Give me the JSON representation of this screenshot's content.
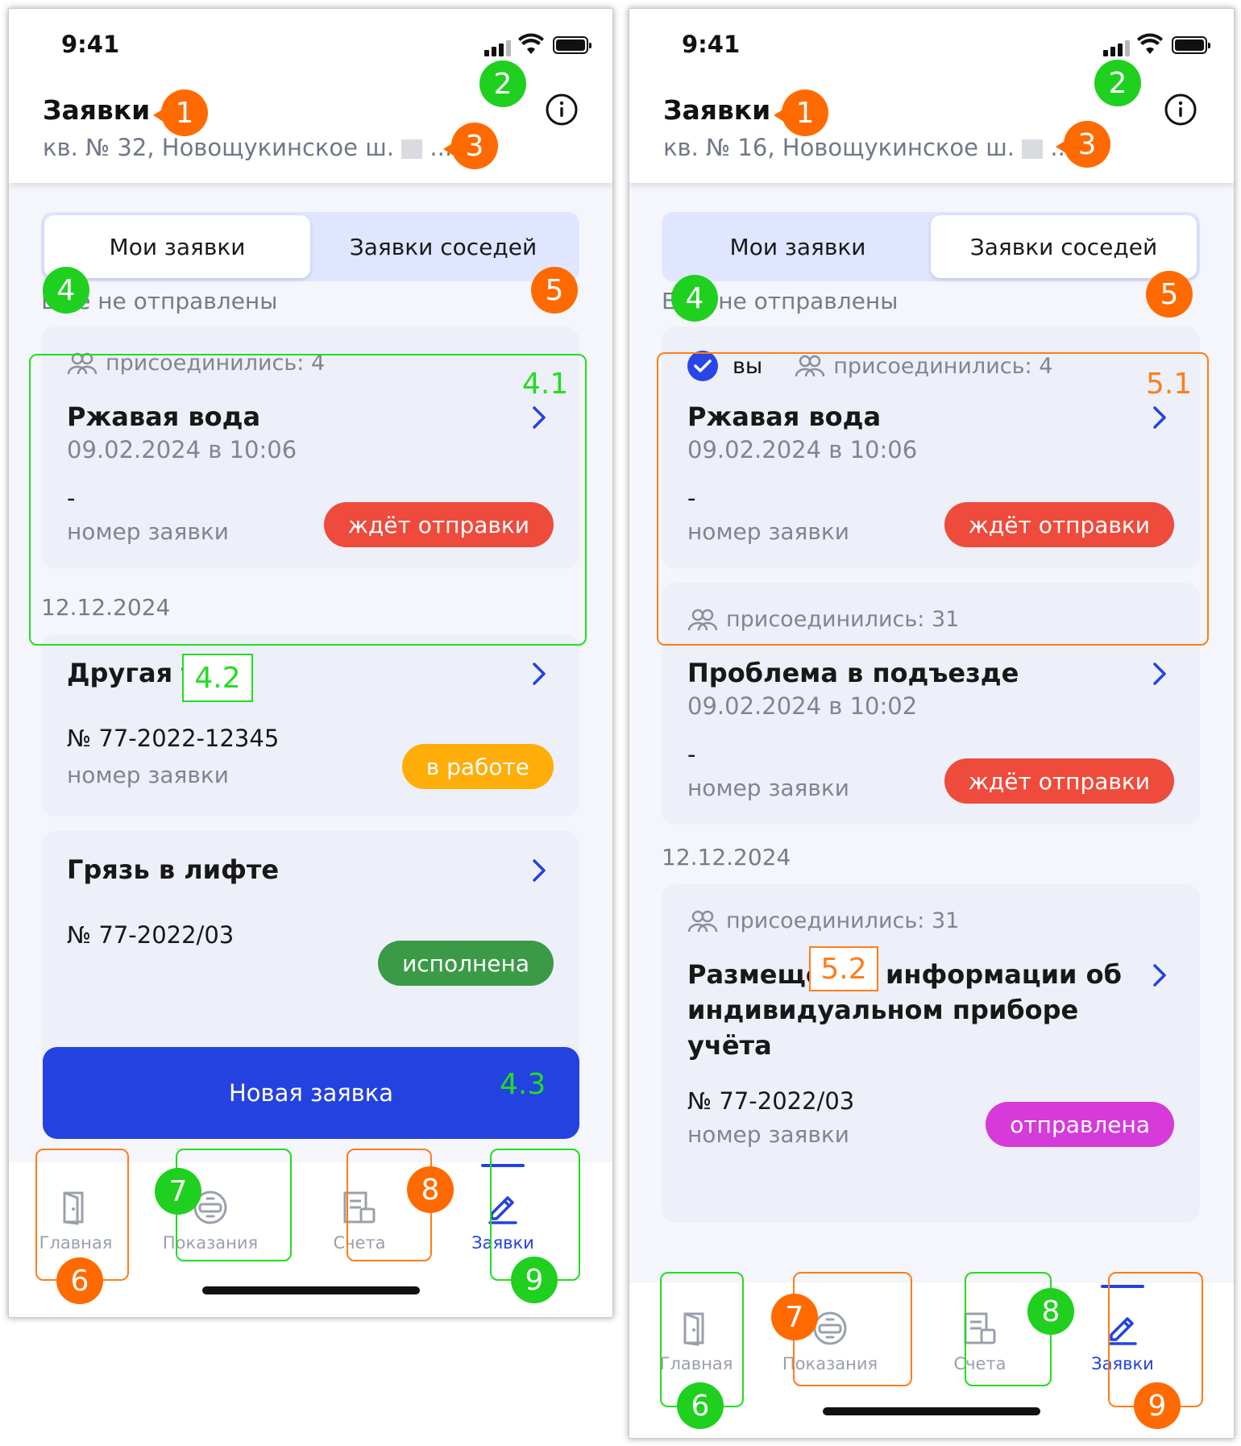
{
  "screens": [
    {
      "status": {
        "time": "9:41"
      },
      "header": {
        "title": "Заявки",
        "address": "кв. № 32, Новощукинское ш.",
        "address_tail": "..."
      },
      "tabs": {
        "mine": "Мои заявки",
        "neighbors": "Заявки соседей",
        "active": "mine"
      },
      "section_unsent": "Ещё не отправлены",
      "section_date": "12.12.2024",
      "cards": [
        {
          "joined": "присоединились: 4",
          "title": "Ржавая вода",
          "date": "09.02.2024 в 10:06",
          "number": "-",
          "number_label": "номер заявки",
          "status": "ждёт отправки",
          "status_color": "#ee4b3c"
        },
        {
          "title": "Другая тема",
          "number": "№ 77-2022-12345",
          "number_label": "номер заявки",
          "status": "в работе",
          "status_color": "#ffad08"
        },
        {
          "title": "Грязь в лифте",
          "number": "№ 77-2022/03",
          "status": "исполнена",
          "status_color": "#3a9a46"
        }
      ],
      "new_button": "Новая заявка",
      "tabbar": [
        "Главная",
        "Показания",
        "Счета",
        "Заявки"
      ],
      "annotations": {
        "n1": "1",
        "n2": "2",
        "n3": "3",
        "n4": "4",
        "n5": "5",
        "n6": "6",
        "n7": "7",
        "n8": "8",
        "n9": "9",
        "l41": "4.1",
        "l42": "4.2",
        "l43": "4.3"
      }
    },
    {
      "status": {
        "time": "9:41"
      },
      "header": {
        "title": "Заявки",
        "address": "кв. № 16, Новощукинское ш.",
        "address_tail": "..."
      },
      "tabs": {
        "mine": "Мои заявки",
        "neighbors": "Заявки соседей",
        "active": "neighbors"
      },
      "section_unsent": "Ещё не отправлены",
      "section_date": "12.12.2024",
      "cards": [
        {
          "you": "вы",
          "joined": "присоединились: 4",
          "title": "Ржавая вода",
          "date": "09.02.2024 в 10:06",
          "number": "-",
          "number_label": "номер заявки",
          "status": "ждёт отправки",
          "status_color": "#ee4b3c"
        },
        {
          "joined": "присоединились: 31",
          "title": "Проблема в подъезде",
          "date": "09.02.2024 в 10:02",
          "number": "-",
          "number_label": "номер заявки",
          "status": "ждёт отправки",
          "status_color": "#ee4b3c"
        },
        {
          "joined": "присоединились: 31",
          "title": "Размещение информации об индивидуальном приборе учёта",
          "number": "№ 77-2022/03",
          "number_label": "номер заявки",
          "status": "отправлена",
          "status_color": "#d63ad9"
        }
      ],
      "tabbar": [
        "Главная",
        "Показания",
        "Счета",
        "Заявки"
      ],
      "annotations": {
        "n1": "1",
        "n2": "2",
        "n3": "3",
        "n4": "4",
        "n5": "5",
        "n6": "6",
        "n7": "7",
        "n8": "8",
        "n9": "9",
        "l51": "5.1",
        "l52": "5.2"
      }
    }
  ],
  "colors": {
    "accent": "#2442e0",
    "orange_marker": "#ff6a00",
    "green_marker": "#1fd01f"
  }
}
